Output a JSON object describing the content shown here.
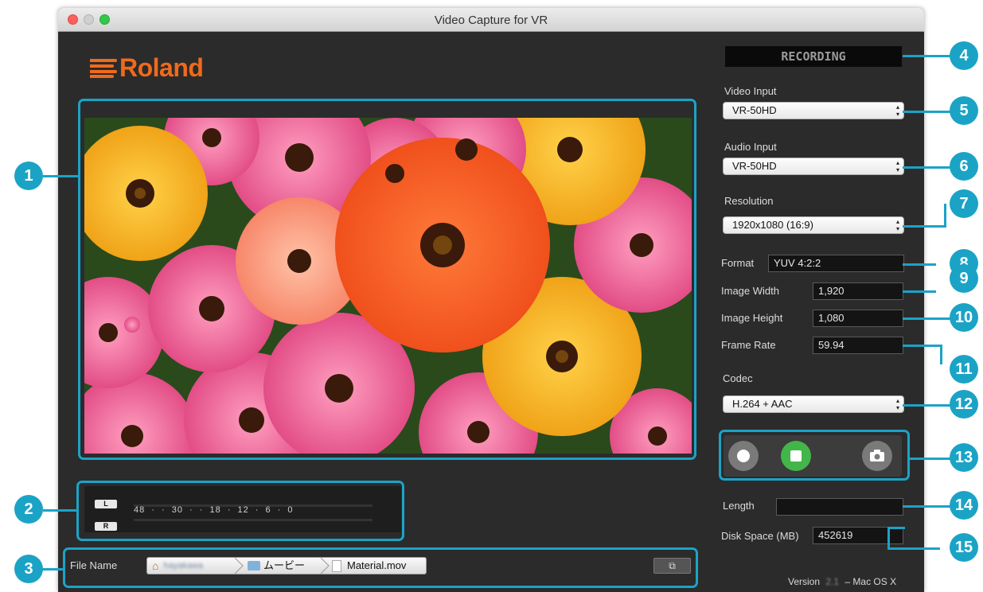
{
  "window": {
    "title": "Video Capture for VR"
  },
  "status": {
    "recording": "RECORDING"
  },
  "video_input": {
    "label": "Video Input",
    "value": "VR-50HD"
  },
  "audio_input": {
    "label": "Audio Input",
    "value": "VR-50HD"
  },
  "resolution": {
    "label": "Resolution",
    "value": "1920x1080 (16:9)"
  },
  "format": {
    "label": "Format",
    "value": "YUV 4:2:2"
  },
  "image_width": {
    "label": "Image Width",
    "value": "1,920"
  },
  "image_height": {
    "label": "Image Height",
    "value": "1,080"
  },
  "frame_rate": {
    "label": "Frame Rate",
    "value": "59.94"
  },
  "codec": {
    "label": "Codec",
    "value": "H.264 + AAC"
  },
  "length": {
    "label": "Length",
    "value": ""
  },
  "disk_space": {
    "label": "Disk Space (MB)",
    "value": "452619"
  },
  "meter": {
    "left": "L",
    "right": "R",
    "scale": "48 · · 30 · · 18 · 12 · 6 · 0"
  },
  "file": {
    "label": "File Name",
    "path": [
      "hayakawa",
      "ムービー",
      "Material.mov"
    ]
  },
  "version": {
    "text": "Version",
    "suffix": "– Mac OS X"
  },
  "callouts": [
    "1",
    "2",
    "3",
    "4",
    "5",
    "6",
    "7",
    "8",
    "9",
    "10",
    "11",
    "12",
    "13",
    "14",
    "15"
  ],
  "colors": {
    "accent": "#1ba3c6",
    "brand": "#f06a1c",
    "stop_button": "#43b649"
  }
}
